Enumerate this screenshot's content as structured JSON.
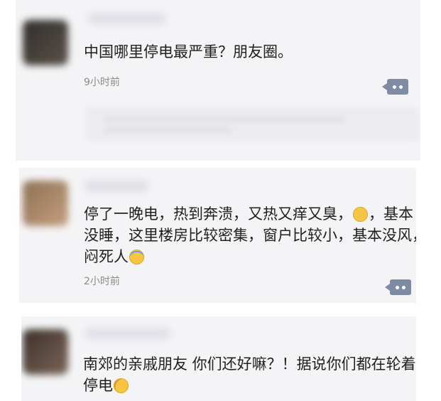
{
  "posts": [
    {
      "text_lines": [
        "中国哪里停电最严重？朋友圈。"
      ],
      "time": "9小时前"
    },
    {
      "text_lines": [
        "停了一晚电，热到奔溃，又热又痒又臭，",
        "，基本",
        "没睡，这里楼房比较密集，窗户比较小，基本没风，",
        "闷死人"
      ],
      "time": "2小时前"
    },
    {
      "text_lines": [
        "南郊的亲戚朋友  你们还好嘛？！据说你们都在轮着",
        "停电"
      ]
    }
  ],
  "icons": {
    "more": "more-options-icon",
    "emoji_sweat": "sweat-emoji-icon",
    "emoji_laugh_cry": "laugh-cry-emoji-icon",
    "emoji_thinking": "thinking-emoji-icon"
  },
  "colors": {
    "card_background": "#f4f4f6",
    "primary_text": "#1f1f1f",
    "timestamp": "#8c8c8c",
    "action_button": "#7f8ba2"
  }
}
